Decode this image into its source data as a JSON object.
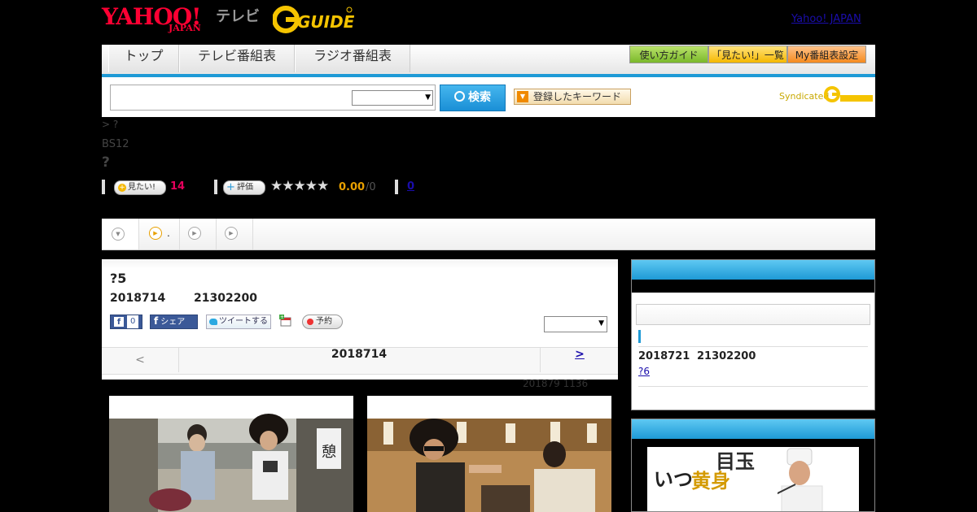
{
  "header": {
    "yahoo_logo_text": "YAHOO!",
    "yahoo_logo_sub": "JAPAN",
    "tv_label": "テレビ",
    "gguide_logo_text": "GUIDE",
    "yahoo_japan_link": "Yahoo! JAPAN"
  },
  "nav": {
    "tabs": [
      "トップ",
      "テレビ番組表",
      "ラジオ番組表"
    ],
    "guide_buttons": [
      "使い方ガイド",
      "「見たい!」一覧",
      "My番組表設定"
    ]
  },
  "search": {
    "button_label": "検索",
    "keyword_button_label": "登録したキーワード",
    "syndicated_label": "Syndicated"
  },
  "program": {
    "breadcrumb": "> ?",
    "channel": "BS12",
    "title": "?",
    "want_label": "見たい!",
    "want_count": "14",
    "rate_label": "評価",
    "stars": "★★★★★",
    "rating_score": "0.00",
    "rating_total": "/0",
    "review_count": "0"
  },
  "subtabs": [
    ".",
    "",
    ""
  ],
  "episode": {
    "title": "?5",
    "date": "2018714",
    "time": "21302200",
    "like_count": "0",
    "share_label": "シェア",
    "tweet_label": "ツイートする",
    "reserve_label": "予約",
    "pager_prev": "<",
    "pager_date": "2018714",
    "pager_next": ">"
  },
  "update_info": "201879  1136",
  "sidebar": {
    "next_date": "2018721",
    "next_time": "21302200",
    "next_link": "?6"
  },
  "ad": {
    "text_left": "いつ",
    "text_mid": "目玉",
    "text_right": "黄身"
  },
  "colors": {
    "accent_blue": "#1e9ad6",
    "yahoo_red": "#ff0033",
    "gguide_yellow": "#f5c400",
    "want_pink": "#e6005c",
    "rating_orange": "#e8a000"
  }
}
